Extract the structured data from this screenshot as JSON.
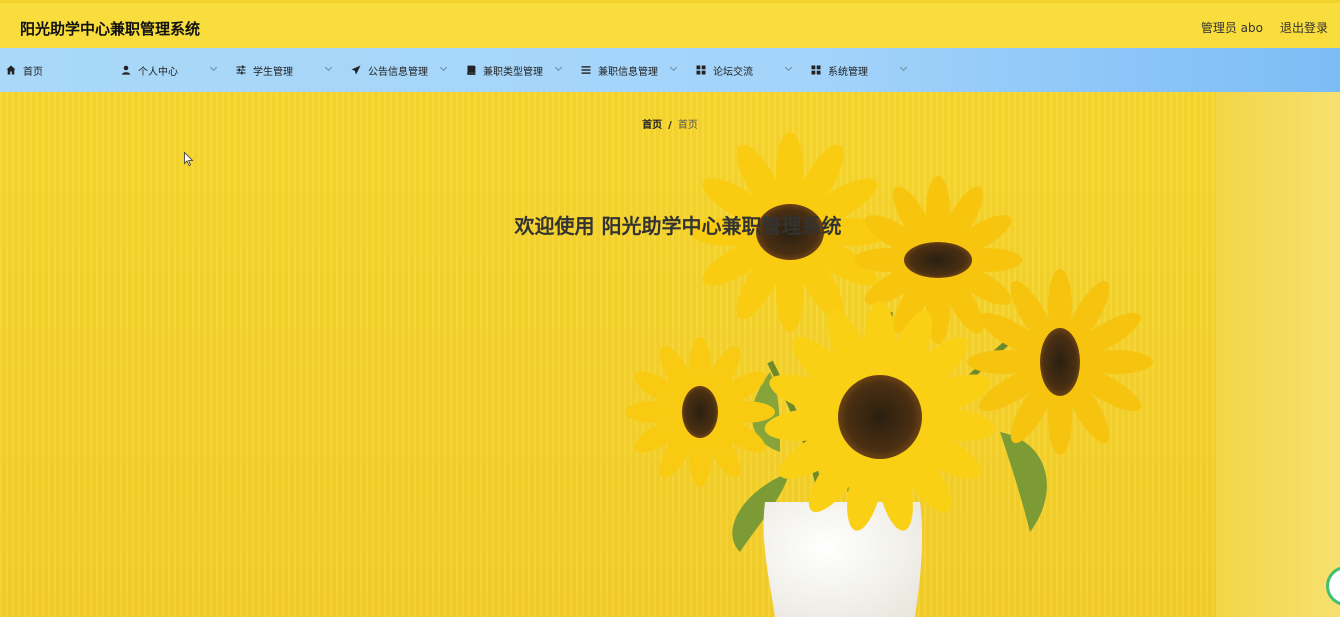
{
  "header": {
    "title": "阳光助学中心兼职管理系统",
    "user_label": "管理员 abo",
    "logout_label": "退出登录"
  },
  "nav": {
    "items": [
      {
        "label": "首页",
        "icon": "home-icon"
      },
      {
        "label": "个人中心",
        "icon": "user-icon"
      },
      {
        "label": "学生管理",
        "icon": "sliders-icon"
      },
      {
        "label": "公告信息管理",
        "icon": "send-icon"
      },
      {
        "label": "兼职类型管理",
        "icon": "book-icon"
      },
      {
        "label": "兼职信息管理",
        "icon": "list-icon"
      },
      {
        "label": "论坛交流",
        "icon": "grid-icon"
      },
      {
        "label": "系统管理",
        "icon": "grid-icon"
      }
    ]
  },
  "breadcrumb": {
    "home": "首页",
    "separator": "/",
    "current": "首页"
  },
  "main": {
    "welcome": "欢迎使用 阳光助学中心兼职管理系统"
  },
  "colors": {
    "header_bg": "#f8dd3c",
    "nav_bg": "#a9d8f8",
    "banner_bg": "#f7d22c"
  }
}
